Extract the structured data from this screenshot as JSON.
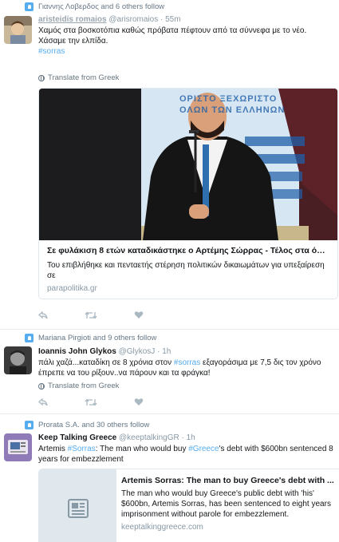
{
  "tweets": [
    {
      "context": "Γιαννης Λοβερδος and 6 others follow",
      "fullname": "aristeidis romaios",
      "handle": "@arisromaios",
      "time": "· 55m",
      "text_before": "Χαμός στα βοσκοτόπια καθώς πρόβατα πέφτουν από τα σύννεφα με το νέο. Χάσαμε την ελπίδα.",
      "hashtag": "#sorras",
      "translate": "Translate from Greek",
      "card": {
        "photo_sign": "ΟΡΙΣΤΟ ΞΕΧΩΡΙΣΤΟ ΟΛΩΝ ΤΩΝ ΕΛΛΗΝΩΝ",
        "title": "Σε φυλάκιση 8 ετών καταδικάστηκε ο Αρτέμης Σώρρας - Τέλος στα όνε...",
        "description": "Του επιβλήθηκε και πενταετής στέρηση πολιτικών δικαιωμάτων για υπεξαίρεση σε",
        "domain": "parapolitika.gr"
      }
    },
    {
      "context": "Mariana Pirgioti and 9 others follow",
      "fullname": "Ioannis John Glykos",
      "handle": "@GlykosJ",
      "time": "· 1h",
      "text_a": "πάλι χαζά...καταδίκη σε 8 χρόνια στον ",
      "hashtag": "#sorras",
      "text_b": " εξαγοράσιμα με 7,5 δις τον χρόνο έπρεπε να του ρίξουν..να πάρουν και τα φράγκα!",
      "translate": "Translate from Greek"
    },
    {
      "context": "Prorata S.A. and 30 others follow",
      "fullname": "Keep Talking Greece",
      "handle": "@keeptalkingGR",
      "time": "· 1h",
      "text_a": "Artemis ",
      "hashtag1": "#Sorras",
      "text_b": ": The man who would buy ",
      "hashtag2": "#Greece",
      "text_c": "'s debt with $600bn sentenced 8 years for embezzlement",
      "card": {
        "title": "Artemis Sorras: The man to buy Greece's debt with ...",
        "description": "The man who would buy Greece's public debt with 'his' $600bn, Artemis Sorras, has been sentenced to eight years imprisonment without parole for embezzlement.",
        "domain": "keeptalkinggreece.com"
      }
    }
  ],
  "icons": [
    "follow-context-icon",
    "globe-icon",
    "reply-icon",
    "retweet-icon",
    "like-icon",
    "article-placeholder-icon"
  ],
  "colors": {
    "link": "#55acee",
    "secondary": "#8899a6",
    "border": "#e1e8ed"
  }
}
